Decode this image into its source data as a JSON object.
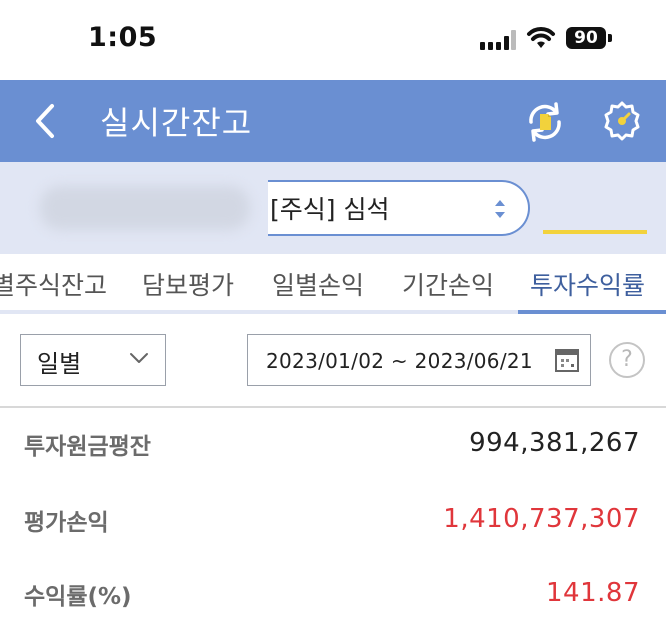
{
  "status_bar": {
    "time": "1:05",
    "battery": "90"
  },
  "header": {
    "title": "실시간잔고",
    "back_icon": "chevron-left-icon",
    "refresh_icon": "refresh-icon",
    "settings_icon": "gear-icon"
  },
  "account": {
    "selected": "[주식] 심석"
  },
  "tabs": [
    {
      "label": "별주식잔고",
      "active": false
    },
    {
      "label": "담보평가",
      "active": false
    },
    {
      "label": "일별손익",
      "active": false
    },
    {
      "label": "기간손익",
      "active": false
    },
    {
      "label": "투자수익률",
      "active": true
    }
  ],
  "filter": {
    "period": "일별",
    "date_range": "2023/01/02 ~ 2023/06/21",
    "help": "?"
  },
  "summary": [
    {
      "label": "투자원금평잔",
      "value": "994,381,267"
    },
    {
      "label": "평가손익",
      "value": "1,410,737,307"
    },
    {
      "label": "수익률(%)",
      "value": "141.87"
    }
  ],
  "colors": {
    "header_bg": "#6a8fd2",
    "account_bg": "#e1e6f4",
    "accent_yellow": "#f2d23c",
    "profit_red": "#e0363b"
  }
}
